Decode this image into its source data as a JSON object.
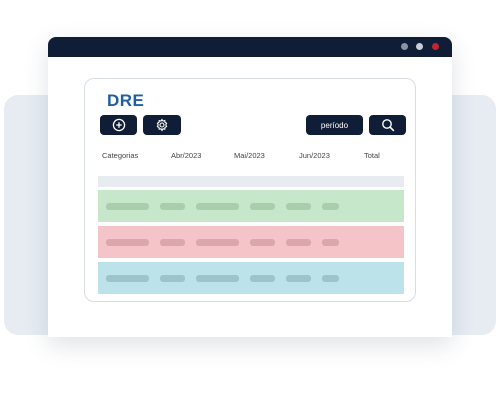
{
  "window": {
    "controls": [
      "minimize",
      "maximize",
      "close"
    ],
    "colors": {
      "titlebar": "#0f1e36",
      "close": "#c0272d"
    }
  },
  "report": {
    "title": "DRE",
    "toolbar": {
      "add_icon": "plus-circle-icon",
      "settings_icon": "gear-icon",
      "period_label": "período",
      "search_icon": "search-icon"
    },
    "columns": [
      "Categorias",
      "Abr/2023",
      "Mai/2023",
      "Jun/2023",
      "Total"
    ],
    "rows": [
      {
        "kind": "header-placeholder",
        "color": "#e8ebef"
      },
      {
        "kind": "placeholder",
        "color": "#c6e7c9"
      },
      {
        "kind": "placeholder",
        "color": "#f4c4c8"
      },
      {
        "kind": "placeholder",
        "color": "#bde3ea"
      }
    ],
    "accent": "#1f5fa0"
  }
}
